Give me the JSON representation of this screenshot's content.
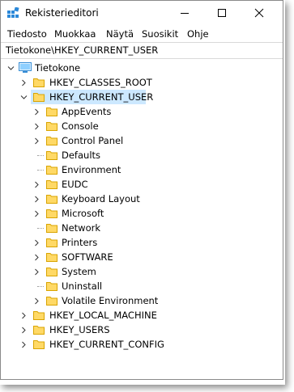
{
  "window": {
    "title": "Rekisterieditori",
    "accent": "#0078d7"
  },
  "menu": [
    "Tiedosto",
    "Muokkaa",
    "Näytä",
    "Suosikit",
    "Ohje"
  ],
  "address": "Tietokone\\HKEY_CURRENT_USER",
  "tree": {
    "root": "Tietokone",
    "hives": {
      "classes_root": "HKEY_CLASSES_ROOT",
      "current_user": "HKEY_CURRENT_USER",
      "local_machine": "HKEY_LOCAL_MACHINE",
      "users": "HKEY_USERS",
      "current_config": "HKEY_CURRENT_CONFIG"
    },
    "current_user_children": [
      {
        "label": "AppEvents",
        "expandable": true
      },
      {
        "label": "Console",
        "expandable": true
      },
      {
        "label": "Control Panel",
        "expandable": true
      },
      {
        "label": "Defaults",
        "expandable": false
      },
      {
        "label": "Environment",
        "expandable": false
      },
      {
        "label": "EUDC",
        "expandable": true
      },
      {
        "label": "Keyboard Layout",
        "expandable": true
      },
      {
        "label": "Microsoft",
        "expandable": true
      },
      {
        "label": "Network",
        "expandable": false
      },
      {
        "label": "Printers",
        "expandable": true
      },
      {
        "label": "SOFTWARE",
        "expandable": true
      },
      {
        "label": "System",
        "expandable": true
      },
      {
        "label": "Uninstall",
        "expandable": false
      },
      {
        "label": "Volatile Environment",
        "expandable": true
      }
    ],
    "selected": "HKEY_CURRENT_USER"
  }
}
